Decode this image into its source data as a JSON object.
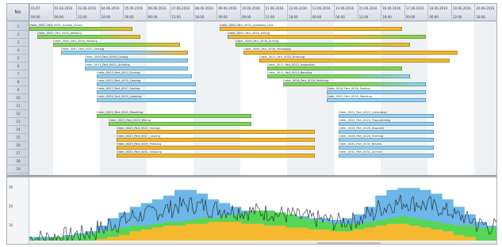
{
  "row_header_label": "No",
  "timescale": {
    "top": [
      "01/07",
      "02.06.2016",
      "03.06.2016",
      "04.06.2016",
      "05.06.2016",
      "06.06.2016",
      "07.06.2016",
      "08.06.2016",
      "09.06.2016",
      "10.06.2016",
      "11.06.2016",
      "12.06.2016",
      "13.06.2016",
      "14.06.2016",
      "15.06.2016",
      "16.06.2016",
      "17.06.2016",
      "18.06.2016",
      "19.06.2016",
      "20.06.2016"
    ],
    "bottom": [
      "00:00",
      "06:00",
      "12:00",
      "18:00",
      "00:00",
      "06:00",
      "12:00",
      "18:00",
      "00:00",
      "06:00",
      "12:00",
      "18:00",
      "00:00",
      "06:00",
      "12:00",
      "18:00",
      "00:00",
      "06:00",
      "12:00",
      "18:00"
    ]
  },
  "rows": [
    "1",
    "2",
    "3",
    "4",
    "5",
    "6",
    "7",
    "8",
    "9",
    "10",
    "11",
    "12",
    "13",
    "14",
    "15",
    "16",
    "17",
    "18",
    "19"
  ],
  "tasks": [
    {
      "row": 0,
      "start": 0,
      "end": 130,
      "label": "Order_0001_Part_0001_Quality_Check",
      "color": "#7ed957",
      "end_color": "#f5b82e"
    },
    {
      "row": 0,
      "start": 240,
      "end": 470,
      "label": "Order_0002_Part_0002_Assembly_Line",
      "color": "#f5b82e",
      "end_color": "#f5b82e"
    },
    {
      "row": 1,
      "start": 10,
      "end": 140,
      "label": "Order_0003_Part_0003_Welding",
      "color": "#7ed957",
      "end_color": "#f5b82e"
    },
    {
      "row": 1,
      "start": 250,
      "end": 500,
      "label": "Order_0004_Part_0004_Milling",
      "color": "#f5b82e",
      "end_color": "#7ed957"
    },
    {
      "row": 2,
      "start": 30,
      "end": 190,
      "label": "Order_0005_Part_0005_Painting",
      "color": "#7ed957",
      "end_color": "#f5b82e"
    },
    {
      "row": 2,
      "start": 260,
      "end": 480,
      "label": "Order_0006_Part_0006_Drilling",
      "color": "#7ed957",
      "end_color": "#f5b82e"
    },
    {
      "row": 3,
      "start": 40,
      "end": 200,
      "label": "Order_0007_Part_0007_Testing",
      "color": "#8fd3f4",
      "end_color": "#f5b82e"
    },
    {
      "row": 3,
      "start": 270,
      "end": 540,
      "label": "Order_0008_Part_0008_Packaging",
      "color": "#f5b82e",
      "end_color": "#f5b82e"
    },
    {
      "row": 4,
      "start": 70,
      "end": 200,
      "label": "Order_0009_Part_0009_Cutting",
      "color": "#8fd3f4",
      "end_color": "#8fd3f4"
    },
    {
      "row": 4,
      "start": 290,
      "end": 530,
      "label": "Order_0010_Part_0010_Finishing",
      "color": "#f5b82e",
      "end_color": "#f5b82e"
    },
    {
      "row": 5,
      "start": 70,
      "end": 200,
      "label": "Order_0011_Part_0011_Grinding",
      "color": "#8fd3f4",
      "end_color": "#8fd3f4"
    },
    {
      "row": 5,
      "start": 300,
      "end": 470,
      "label": "Order_0012_Part_0012_Inspection",
      "color": "#7ed957",
      "end_color": "#7ed957"
    },
    {
      "row": 6,
      "start": 85,
      "end": 205,
      "label": "Order_0013_Part_0013_Turning",
      "color": "#8fd3f4",
      "end_color": "#8fd3f4"
    },
    {
      "row": 6,
      "start": 300,
      "end": 480,
      "label": "Order_0014_Part_0014_Bending",
      "color": "#7ed957",
      "end_color": "#8fd3f4"
    },
    {
      "row": 7,
      "start": 85,
      "end": 210,
      "label": "Order_0015_Part_0015_Coating",
      "color": "#8fd3f4",
      "end_color": "#8fd3f4"
    },
    {
      "row": 7,
      "start": 320,
      "end": 500,
      "label": "Order_0016_Part_0016_Polishing",
      "color": "#7ed957",
      "end_color": "#8fd3f4"
    },
    {
      "row": 8,
      "start": 85,
      "end": 210,
      "label": "Order_0017_Part_0017_Sorting",
      "color": "#8fd3f4",
      "end_color": "#8fd3f4"
    },
    {
      "row": 8,
      "start": 375,
      "end": 500,
      "label": "Order_0018_Part_0018_Sealing",
      "color": "#8fd3f4",
      "end_color": "#8fd3f4"
    },
    {
      "row": 9,
      "start": 85,
      "end": 210,
      "label": "Order_0019_Part_0019_Labeling",
      "color": "#8fd3f4",
      "end_color": "#8fd3f4"
    },
    {
      "row": 9,
      "start": 375,
      "end": 500,
      "label": "Order_0020_Part_0020_Stacking",
      "color": "#8fd3f4",
      "end_color": "#8fd3f4"
    },
    {
      "row": 11,
      "start": 85,
      "end": 280,
      "label": "Order_0021_Part_0021_Mounting",
      "color": "#7ed957",
      "end_color": "#7ed957"
    },
    {
      "row": 11,
      "start": 390,
      "end": 510,
      "label": "Order_0022_Part_0022_Calibration",
      "color": "#8fd3f4",
      "end_color": "#8fd3f4"
    },
    {
      "row": 12,
      "start": 100,
      "end": 280,
      "label": "Order_0023_Part_0023_Wiring",
      "color": "#7ed957",
      "end_color": "#7ed957"
    },
    {
      "row": 12,
      "start": 390,
      "end": 510,
      "label": "Order_0024_Part_0024_Programming",
      "color": "#8fd3f4",
      "end_color": "#8fd3f4"
    },
    {
      "row": 13,
      "start": 110,
      "end": 360,
      "label": "Order_0025_Part_0025_Storage",
      "color": "#f5b82e",
      "end_color": "#f5b82e"
    },
    {
      "row": 13,
      "start": 390,
      "end": 510,
      "label": "Order_0026_Part_0026_Dispatch",
      "color": "#8fd3f4",
      "end_color": "#8fd3f4"
    },
    {
      "row": 14,
      "start": 110,
      "end": 360,
      "label": "Order_0027_Part_0027_Casting",
      "color": "#f5b82e",
      "end_color": "#f5b82e"
    },
    {
      "row": 14,
      "start": 390,
      "end": 510,
      "label": "Order_0028_Part_0028_Forming",
      "color": "#8fd3f4",
      "end_color": "#8fd3f4"
    },
    {
      "row": 15,
      "start": 110,
      "end": 360,
      "label": "Order_0029_Part_0029_Pressing",
      "color": "#f5b82e",
      "end_color": "#f5b82e"
    },
    {
      "row": 15,
      "start": 390,
      "end": 510,
      "label": "Order_0030_Part_0030_Review",
      "color": "#8fd3f4",
      "end_color": "#8fd3f4"
    },
    {
      "row": 16,
      "start": 110,
      "end": 360,
      "label": "Order_0031_Part_0031_Shipping",
      "color": "#f5b82e",
      "end_color": "#f5b82e"
    },
    {
      "row": 16,
      "start": 390,
      "end": 510,
      "label": "Order_0032_Part_0032_Archive",
      "color": "#8fd3f4",
      "end_color": "#8fd3f4"
    }
  ],
  "load_chart": {
    "y_ticks": [
      "30",
      "20",
      "10"
    ],
    "colors": {
      "blue": "#6cb6e8",
      "green": "#55d655",
      "orange": "#f5b82e",
      "line": "#222222"
    },
    "blue_levels": [
      2,
      2,
      2,
      3,
      4,
      5,
      8,
      12,
      15,
      18,
      20,
      22,
      24,
      27,
      27,
      25,
      22,
      20,
      18,
      16,
      15,
      14,
      13,
      13,
      13,
      12,
      12,
      11,
      12,
      14,
      18,
      24,
      27,
      28,
      28,
      27,
      25,
      22,
      18,
      14,
      10,
      8
    ],
    "green_levels": [
      1,
      1,
      2,
      2,
      3,
      4,
      5,
      6,
      7,
      8,
      8,
      9,
      10,
      10,
      11,
      12,
      12,
      13,
      14,
      15,
      16,
      16,
      15,
      14,
      12,
      11,
      10,
      9,
      9,
      9,
      10,
      11,
      12,
      13,
      12,
      11,
      10,
      9,
      8,
      8,
      7,
      7
    ],
    "orange_levels": [
      0,
      0,
      0,
      0,
      0,
      0,
      1,
      2,
      3,
      5,
      6,
      7,
      8,
      8,
      9,
      9,
      10,
      10,
      10,
      9,
      9,
      8,
      8,
      7,
      7,
      6,
      6,
      5,
      5,
      6,
      7,
      8,
      9,
      9,
      8,
      7,
      6,
      5,
      3,
      2,
      0,
      0
    ]
  },
  "scroll": {
    "position": 0.71
  }
}
